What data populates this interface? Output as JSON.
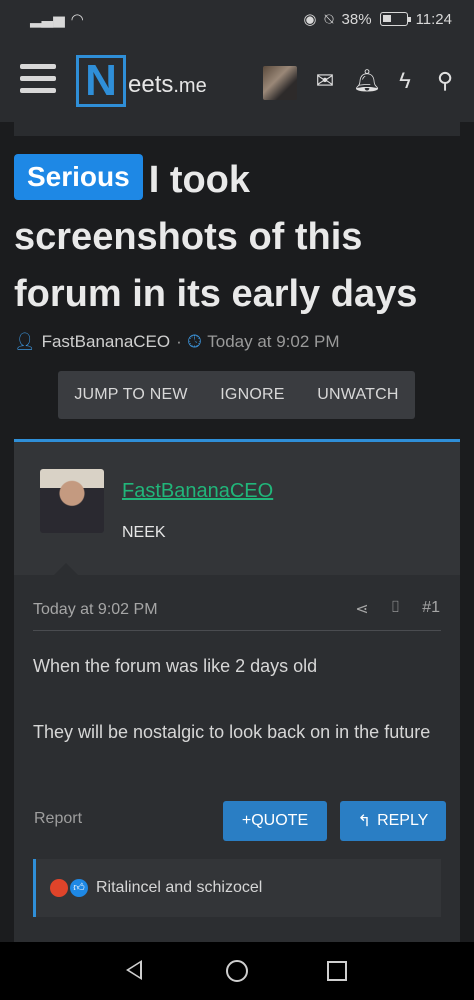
{
  "status": {
    "battery_percent": "38%",
    "time": "11:24",
    "battery_level": 0.38
  },
  "header": {
    "logo_letter": "N",
    "logo_text": "eets",
    "logo_tld": ".me",
    "icons": [
      "envelope-icon",
      "bell-icon",
      "bolt-icon",
      "search-icon"
    ]
  },
  "thread": {
    "prefix": "Serious",
    "title": "I took screenshots of this forum in its early days",
    "author": "FastBananaCEO",
    "separator": "·",
    "time": "Today at 9:02 PM",
    "actions": [
      "JUMP TO NEW",
      "IGNORE",
      "UNWATCH"
    ]
  },
  "post": {
    "username": "FastBananaCEO",
    "user_title": "NEEK",
    "date": "Today at 9:02 PM",
    "number": "#1",
    "body": [
      "When the forum was like 2 days old",
      "They will be nostalgic to look back on in the future"
    ],
    "report": "Report",
    "quote": "QUOTE",
    "quote_prefix": "+",
    "reply": "REPLY",
    "reactions_text": "Ritalincel and schizocel"
  }
}
